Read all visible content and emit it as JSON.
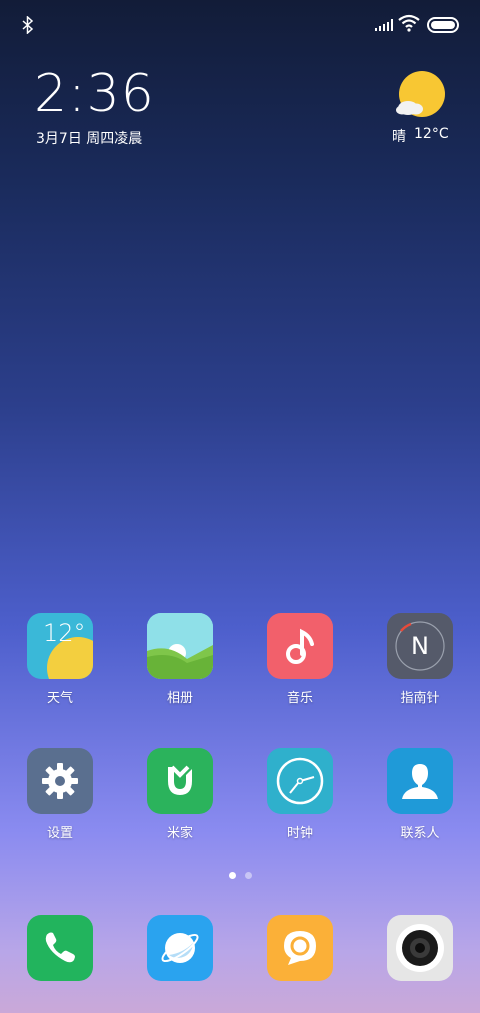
{
  "status_bar": {
    "bluetooth_icon": "bluetooth-icon",
    "signal_icon": "signal-icon",
    "wifi_icon": "wifi-icon",
    "battery_icon": "battery-icon"
  },
  "clock": {
    "time": "2:36",
    "date": "3月7日 周四凌晨"
  },
  "weather_widget": {
    "condition": "晴",
    "temperature": "12°C",
    "icon": "partly-sunny-icon"
  },
  "apps_row1": [
    {
      "label": "天气",
      "icon": "weather-icon",
      "color": "#3ab8d8",
      "tile_temp": "12°"
    },
    {
      "label": "相册",
      "icon": "gallery-icon",
      "color": "#7ed8e0"
    },
    {
      "label": "音乐",
      "icon": "music-icon",
      "color": "#f2606b"
    },
    {
      "label": "指南针",
      "icon": "compass-icon",
      "color": "#555a6a",
      "tile_letter": "N"
    }
  ],
  "apps_row2": [
    {
      "label": "设置",
      "icon": "settings-icon",
      "color": "#5a6f8f"
    },
    {
      "label": "米家",
      "icon": "mijia-icon",
      "color": "#2bb35c"
    },
    {
      "label": "时钟",
      "icon": "clock-icon",
      "color": "#2fb0cc"
    },
    {
      "label": "联系人",
      "icon": "contacts-icon",
      "color": "#1f9ad8"
    }
  ],
  "dock": [
    {
      "icon": "phone-icon",
      "color": "#22b45d"
    },
    {
      "icon": "browser-icon",
      "color": "#2aa3ef"
    },
    {
      "icon": "messages-icon",
      "color": "#fbb038"
    },
    {
      "icon": "camera-icon",
      "color": "#e6e6e6"
    }
  ],
  "page_indicator": {
    "pages": 2,
    "current": 1
  }
}
